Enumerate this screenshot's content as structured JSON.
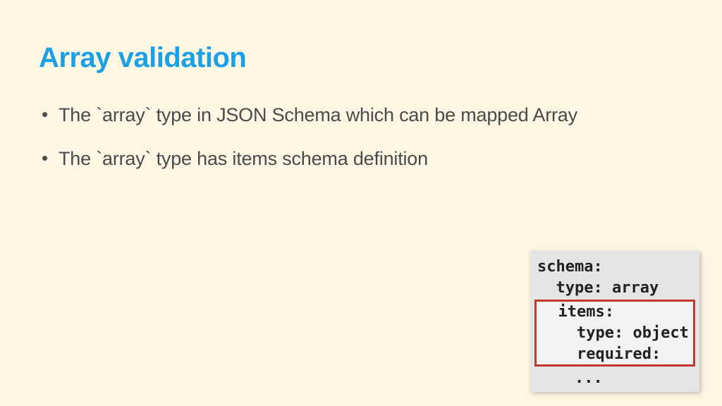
{
  "title": "Array validation",
  "bullets": [
    "The `array` type in JSON Schema which can be mapped Array",
    "The `array` type has items schema definition"
  ],
  "code": {
    "line1": "schema:",
    "line2": "  type: array",
    "highlighted": {
      "h1": "  items:",
      "h2": "    type: object",
      "h3": "    required:"
    },
    "line6": "    ..."
  }
}
